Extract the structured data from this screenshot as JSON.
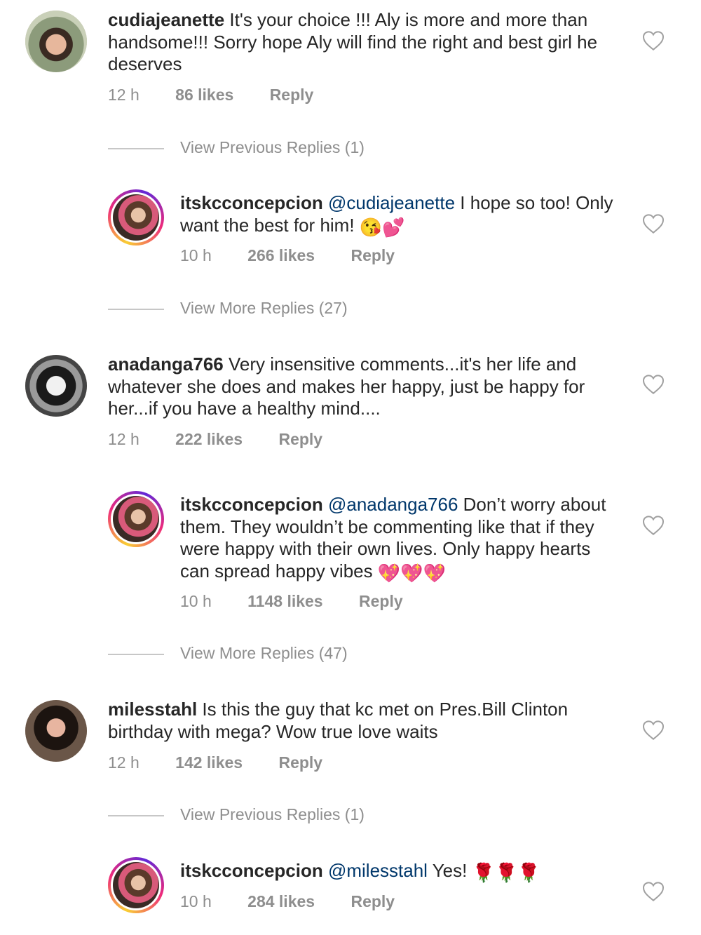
{
  "comments": [
    {
      "username": "cudiajeanette",
      "text": "It's your choice !!! Aly is more and more than handsome!!! Sorry hope Aly will find the right  and best girl he deserves",
      "time": "12 h",
      "likes": "86 likes",
      "reply_label": "Reply",
      "view_replies": "View Previous Replies (1)",
      "reply": {
        "username": "itskcconcepcion",
        "mention": "@cudiajeanette",
        "text": "I hope so too! Only want the best for him!",
        "emoji": "😘💕",
        "time": "10 h",
        "likes": "266 likes",
        "reply_label": "Reply"
      },
      "view_more": "View More Replies (27)"
    },
    {
      "username": "anadanga766",
      "text": "Very insensitive comments...it's her life and whatever she does and makes her happy, just be happy for her...if you have a healthy mind....",
      "time": "12 h",
      "likes": "222 likes",
      "reply_label": "Reply",
      "reply": {
        "username": "itskcconcepcion",
        "mention": "@anadanga766",
        "text": "Don’t worry about them. They wouldn’t be commenting like that if they were happy with their own lives. Only happy hearts can spread happy vibes",
        "emoji": "💖💖💖",
        "time": "10 h",
        "likes": "1148 likes",
        "reply_label": "Reply"
      },
      "view_more": "View More Replies (47)"
    },
    {
      "username": "milesstahl",
      "text": "Is this the guy that kc met on Pres.Bill Clinton birthday with mega? Wow true love waits",
      "time": "12 h",
      "likes": "142 likes",
      "reply_label": "Reply",
      "view_replies": "View Previous Replies (1)",
      "reply": {
        "username": "itskcconcepcion",
        "mention": "@milesstahl",
        "text": "Yes!",
        "emoji": "🌹🌹🌹",
        "time": "10 h",
        "likes": "284 likes",
        "reply_label": "Reply"
      }
    }
  ],
  "icons": {
    "like": "heart-outline-icon"
  },
  "colors": {
    "text": "#262626",
    "muted": "#8e8e8e",
    "mention": "#00376b",
    "divider": "#c7c7c7"
  }
}
